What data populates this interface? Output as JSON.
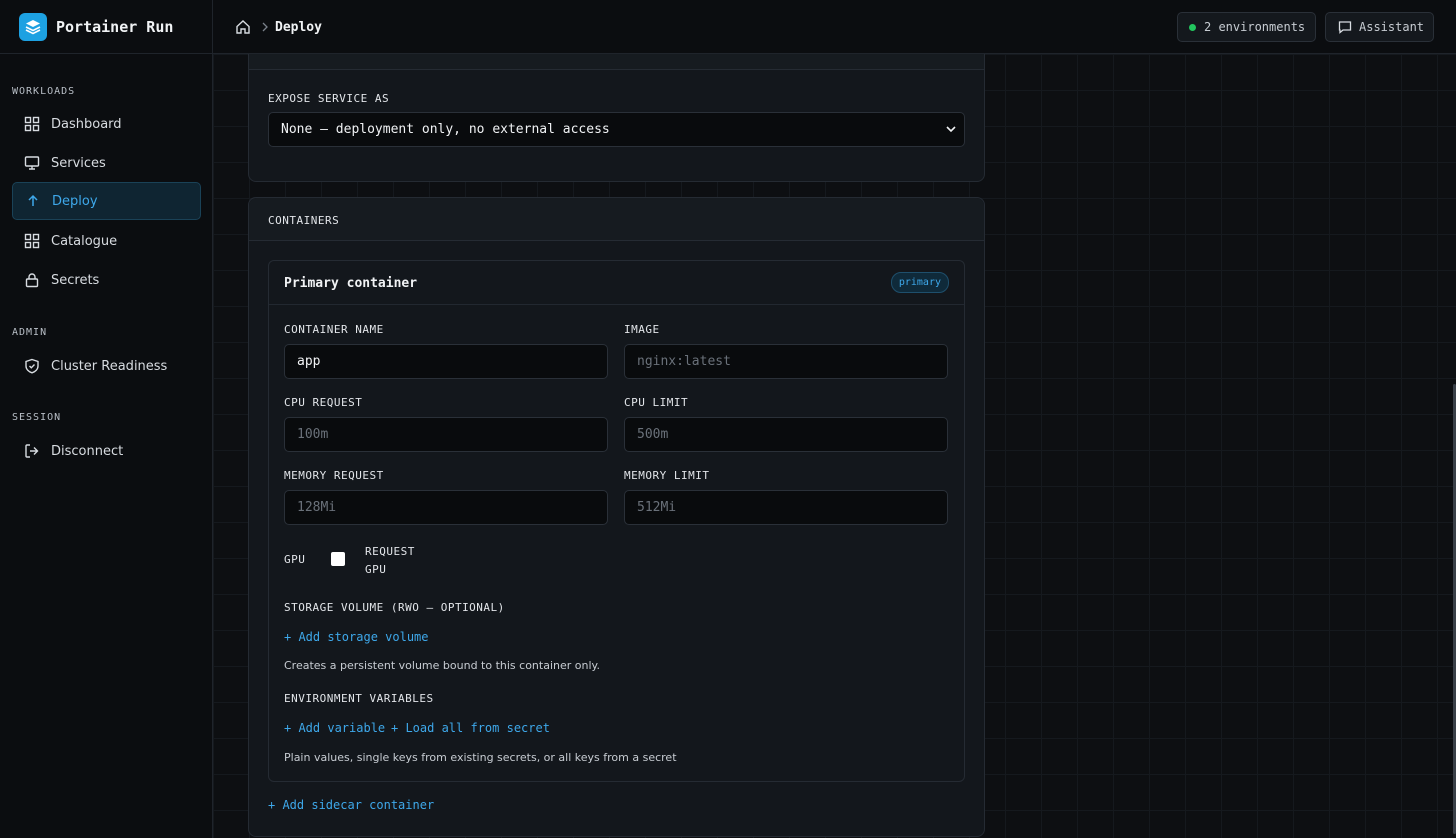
{
  "app": {
    "name": "Portainer Run"
  },
  "sidebar": {
    "sections": [
      {
        "title": "WORKLOADS"
      },
      {
        "title": "ADMIN"
      },
      {
        "title": "SESSION"
      }
    ],
    "items": [
      {
        "label": "Dashboard",
        "icon": "grid-icon"
      },
      {
        "label": "Services",
        "icon": "monitor-icon"
      },
      {
        "label": "Deploy",
        "icon": "arrow-up-icon",
        "active": true
      },
      {
        "label": "Catalogue",
        "icon": "grid-icon"
      },
      {
        "label": "Secrets",
        "icon": "lock-icon"
      },
      {
        "label": "Cluster Readiness",
        "icon": "shield-check-icon"
      },
      {
        "label": "Disconnect",
        "icon": "logout-icon"
      }
    ]
  },
  "topbar": {
    "breadcrumb": "Deploy",
    "environments_label": "2 environments",
    "assistant_label": "Assistant"
  },
  "expose": {
    "label": "EXPOSE SERVICE AS",
    "value": "None — deployment only, no external access"
  },
  "containers": {
    "title": "CONTAINERS",
    "primary": {
      "title": "Primary container",
      "badge": "primary",
      "container_name": {
        "label": "CONTAINER NAME",
        "value": "app"
      },
      "image": {
        "label": "IMAGE",
        "placeholder": "nginx:latest"
      },
      "cpu_request": {
        "label": "CPU REQUEST",
        "placeholder": "100m"
      },
      "cpu_limit": {
        "label": "CPU LIMIT",
        "placeholder": "500m"
      },
      "memory_request": {
        "label": "MEMORY REQUEST",
        "placeholder": "128Mi"
      },
      "memory_limit": {
        "label": "MEMORY LIMIT",
        "placeholder": "512Mi"
      },
      "gpu": {
        "label": "GPU",
        "checkbox_label_1": "REQUEST",
        "checkbox_label_2": "GPU",
        "checked": false
      },
      "storage": {
        "label": "STORAGE VOLUME (RWO — OPTIONAL)",
        "add_link": "+ Add storage volume",
        "help": "Creates a persistent volume bound to this container only."
      },
      "env": {
        "label": "ENVIRONMENT VARIABLES",
        "add_variable": "+ Add variable",
        "load_secret": "+ Load all from secret",
        "help": "Plain values, single keys from existing secrets, or all keys from a secret"
      }
    },
    "add_sidecar": "+ Add sidecar container"
  },
  "colors": {
    "accent": "#3ea8ea",
    "brand": "#1da1e2",
    "status_ok": "#22c55e"
  }
}
